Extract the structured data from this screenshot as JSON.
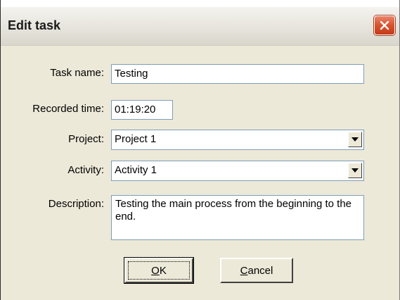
{
  "window": {
    "title": "Edit task"
  },
  "form": {
    "task_name": {
      "label": "Task name:",
      "value": "Testing"
    },
    "recorded_time": {
      "label": "Recorded time:",
      "value": "01:19:20"
    },
    "project": {
      "label": "Project:",
      "value": "Project 1"
    },
    "activity": {
      "label": "Activity:",
      "value": "Activity 1"
    },
    "description": {
      "label": "Description:",
      "value": "Testing the main process from the beginning to the end."
    }
  },
  "buttons": {
    "ok": {
      "accel": "O",
      "rest": "K"
    },
    "cancel": {
      "accel": "C",
      "rest": "ancel"
    }
  },
  "colors": {
    "dialog_bg": "#ece9d8",
    "close_red": "#d8532e",
    "field_border": "#7f9db9"
  }
}
